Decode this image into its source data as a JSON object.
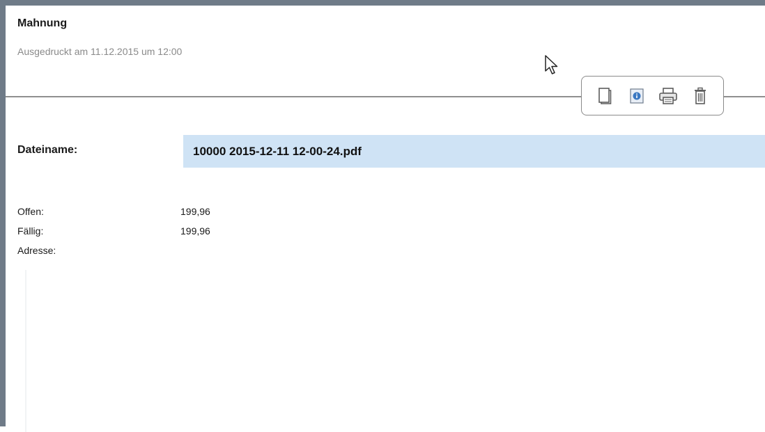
{
  "document": {
    "title": "Mahnung",
    "printed_info": "Ausgedruckt am 11.12.2015 um 12:00"
  },
  "toolbar": {
    "buttons": [
      {
        "icon": "copy-icon"
      },
      {
        "icon": "info-icon"
      },
      {
        "icon": "printer-icon"
      },
      {
        "icon": "trash-icon"
      }
    ]
  },
  "fields": {
    "filename_label": "Dateiname:",
    "filename_value": "10000 2015-12-11 12-00-24.pdf",
    "open_label": "Offen:",
    "open_value": "199,96",
    "due_label": "Fällig:",
    "due_value": "199,96",
    "address_label": "Adresse:"
  },
  "colors": {
    "frame": "#6f7b88",
    "field_highlight": "#cfe3f5",
    "info_accent": "#3a78c2"
  }
}
